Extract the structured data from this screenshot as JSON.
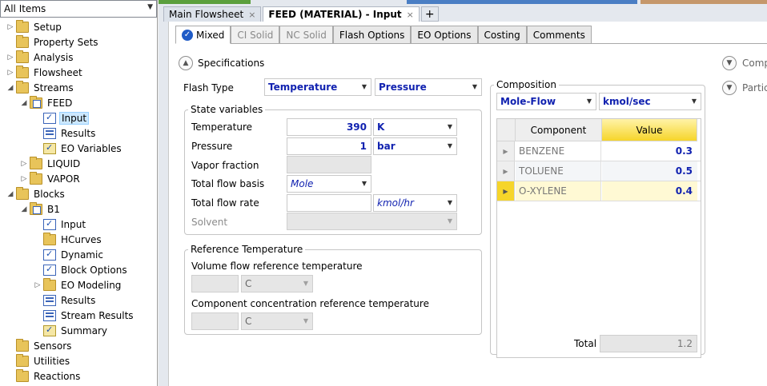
{
  "nav": {
    "selector": "All Items",
    "items": [
      {
        "label": "Setup",
        "tw": "▷",
        "icon": "folder-icon",
        "indent": 0
      },
      {
        "label": "Property Sets",
        "tw": "",
        "icon": "folder-icon",
        "indent": 0
      },
      {
        "label": "Analysis",
        "tw": "▷",
        "icon": "folder-icon",
        "indent": 0
      },
      {
        "label": "Flowsheet",
        "tw": "▷",
        "icon": "folder-icon",
        "indent": 0
      },
      {
        "label": "Streams",
        "tw": "◢",
        "icon": "folder-icon",
        "indent": 0
      },
      {
        "label": "FEED",
        "tw": "◢",
        "icon": "folder-check-icon",
        "indent": 1
      },
      {
        "label": "Input",
        "tw": "",
        "icon": "form-check-icon",
        "indent": 2
      },
      {
        "label": "Results",
        "tw": "",
        "icon": "results-icon",
        "indent": 2
      },
      {
        "label": "EO Variables",
        "tw": "",
        "icon": "eo-check-icon",
        "indent": 2
      },
      {
        "label": "LIQUID",
        "tw": "▷",
        "icon": "folder-icon",
        "indent": 1
      },
      {
        "label": "VAPOR",
        "tw": "▷",
        "icon": "folder-icon",
        "indent": 1
      },
      {
        "label": "Blocks",
        "tw": "◢",
        "icon": "folder-icon",
        "indent": 0
      },
      {
        "label": "B1",
        "tw": "◢",
        "icon": "folder-check-icon",
        "indent": 1
      },
      {
        "label": "Input",
        "tw": "",
        "icon": "form-check-icon",
        "indent": 2
      },
      {
        "label": "HCurves",
        "tw": "",
        "icon": "folder-icon",
        "indent": 2
      },
      {
        "label": "Dynamic",
        "tw": "",
        "icon": "form-check-icon",
        "indent": 2
      },
      {
        "label": "Block Options",
        "tw": "",
        "icon": "form-check-icon",
        "indent": 2
      },
      {
        "label": "EO Modeling",
        "tw": "▷",
        "icon": "folder-icon",
        "indent": 2
      },
      {
        "label": "Results",
        "tw": "",
        "icon": "results-icon",
        "indent": 2
      },
      {
        "label": "Stream Results",
        "tw": "",
        "icon": "results-icon",
        "indent": 2
      },
      {
        "label": "Summary",
        "tw": "",
        "icon": "eo-check-icon",
        "indent": 2
      },
      {
        "label": "Sensors",
        "tw": "",
        "icon": "folder-icon",
        "indent": 0
      },
      {
        "label": "Utilities",
        "tw": "",
        "icon": "folder-icon",
        "indent": 0
      },
      {
        "label": "Reactions",
        "tw": "",
        "icon": "folder-icon",
        "indent": 0
      }
    ],
    "selected_index": 6
  },
  "doc_tabs": {
    "main_flowsheet": "Main Flowsheet",
    "feed_input": "FEED (MATERIAL) - Input",
    "close": "×",
    "add": "+"
  },
  "form_tabs": {
    "mixed": "Mixed",
    "ci_solid": "CI Solid",
    "nc_solid": "NC Solid",
    "flash_options": "Flash Options",
    "eo_options": "EO Options",
    "costing": "Costing",
    "comments": "Comments"
  },
  "specifications": {
    "header": "Specifications",
    "flash_type_label": "Flash Type",
    "flash_type_1": "Temperature",
    "flash_type_2": "Pressure"
  },
  "state_variables": {
    "title": "State variables",
    "temperature_label": "Temperature",
    "temperature_value": "390",
    "temperature_unit": "K",
    "pressure_label": "Pressure",
    "pressure_value": "1",
    "pressure_unit": "bar",
    "vapor_fraction_label": "Vapor fraction",
    "total_flow_basis_label": "Total flow basis",
    "total_flow_basis_value": "Mole",
    "total_flow_rate_label": "Total flow rate",
    "total_flow_rate_unit": "kmol/hr",
    "solvent_label": "Solvent"
  },
  "reference_temperature": {
    "title": "Reference Temperature",
    "volume_label": "Volume flow reference temperature",
    "volume_unit": "C",
    "component_label": "Component concentration reference temperature",
    "component_unit": "C"
  },
  "composition": {
    "title": "Composition",
    "basis": "Mole-Flow",
    "unit": "kmol/sec",
    "header_component": "Component",
    "header_value": "Value",
    "rows": [
      {
        "component": "BENZENE",
        "value": "0.3"
      },
      {
        "component": "TOLUENE",
        "value": "0.5"
      },
      {
        "component": "O-XYLENE",
        "value": "0.4"
      }
    ],
    "total_label": "Total",
    "total_value": "1.2"
  },
  "side_panels": {
    "comp": "Comp",
    "partic": "Partic"
  }
}
